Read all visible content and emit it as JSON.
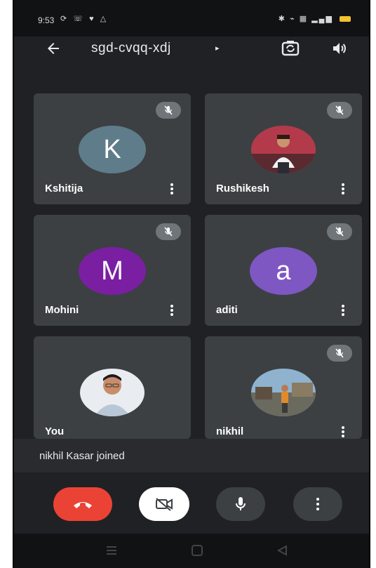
{
  "status_bar": {
    "time": "9:53",
    "left_icons": [
      "signal-sync-icon",
      "wifi-call-icon",
      "heart-icon",
      "bell-icon"
    ],
    "right_icons": [
      "bluetooth-icon",
      "vibrate-icon",
      "network-icon",
      "signal-icon",
      "battery-icon"
    ],
    "battery_color": "#f2c230"
  },
  "header": {
    "meeting_code": "sgd-cvqq-xdj",
    "caret": "▸"
  },
  "participants": [
    {
      "name": "Kshitija",
      "initial": "K",
      "avatar_color": "#5f7c8a",
      "muted": true
    },
    {
      "name": "Rushikesh",
      "initial": "",
      "muted": true
    },
    {
      "name": "Mohini",
      "initial": "M",
      "avatar_color": "#7b1fa2",
      "muted": true
    },
    {
      "name": "aditi",
      "initial": "a",
      "avatar_color": "#7e57c2",
      "muted": true
    },
    {
      "name": "You",
      "initial": "",
      "muted": false
    },
    {
      "name": "nikhil",
      "initial": "",
      "muted": true
    }
  ],
  "toast": {
    "text": "nikhil Kasar joined"
  },
  "controls": {
    "end_call_color": "#ea4335",
    "camera_button_color": "#ffffff",
    "mic_button_color": "#3c4043",
    "more_button_color": "#3c4043"
  }
}
